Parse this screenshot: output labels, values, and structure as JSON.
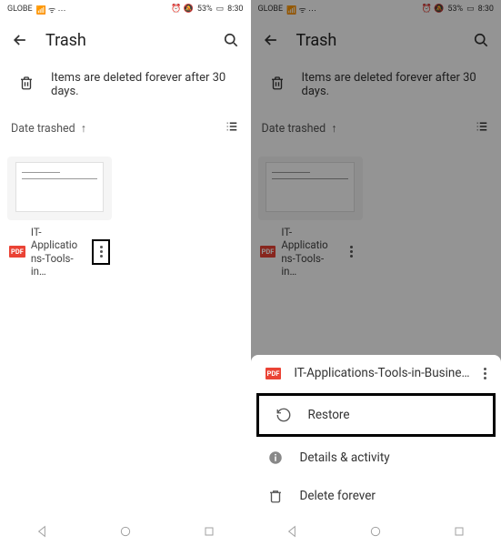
{
  "status": {
    "carrier": "GLOBE",
    "signal_icons": "4G ⫶ 📶 ⋯",
    "battery_pct": "53%",
    "time": "8:30",
    "alarm_dnd": "⏰ 🔕"
  },
  "page_title": "Trash",
  "banner_text": "Items are deleted forever after 30 days.",
  "sort": {
    "label": "Date trashed",
    "direction_icon": "↑"
  },
  "file": {
    "badge": "PDF",
    "name_line1": "IT-Applicatio",
    "name_line2": "ns-Tools-in…",
    "full_name": "IT-Applications-Tools-in-Business-…"
  },
  "sheet": {
    "restore": "Restore",
    "details": "Details & activity",
    "delete": "Delete forever"
  }
}
